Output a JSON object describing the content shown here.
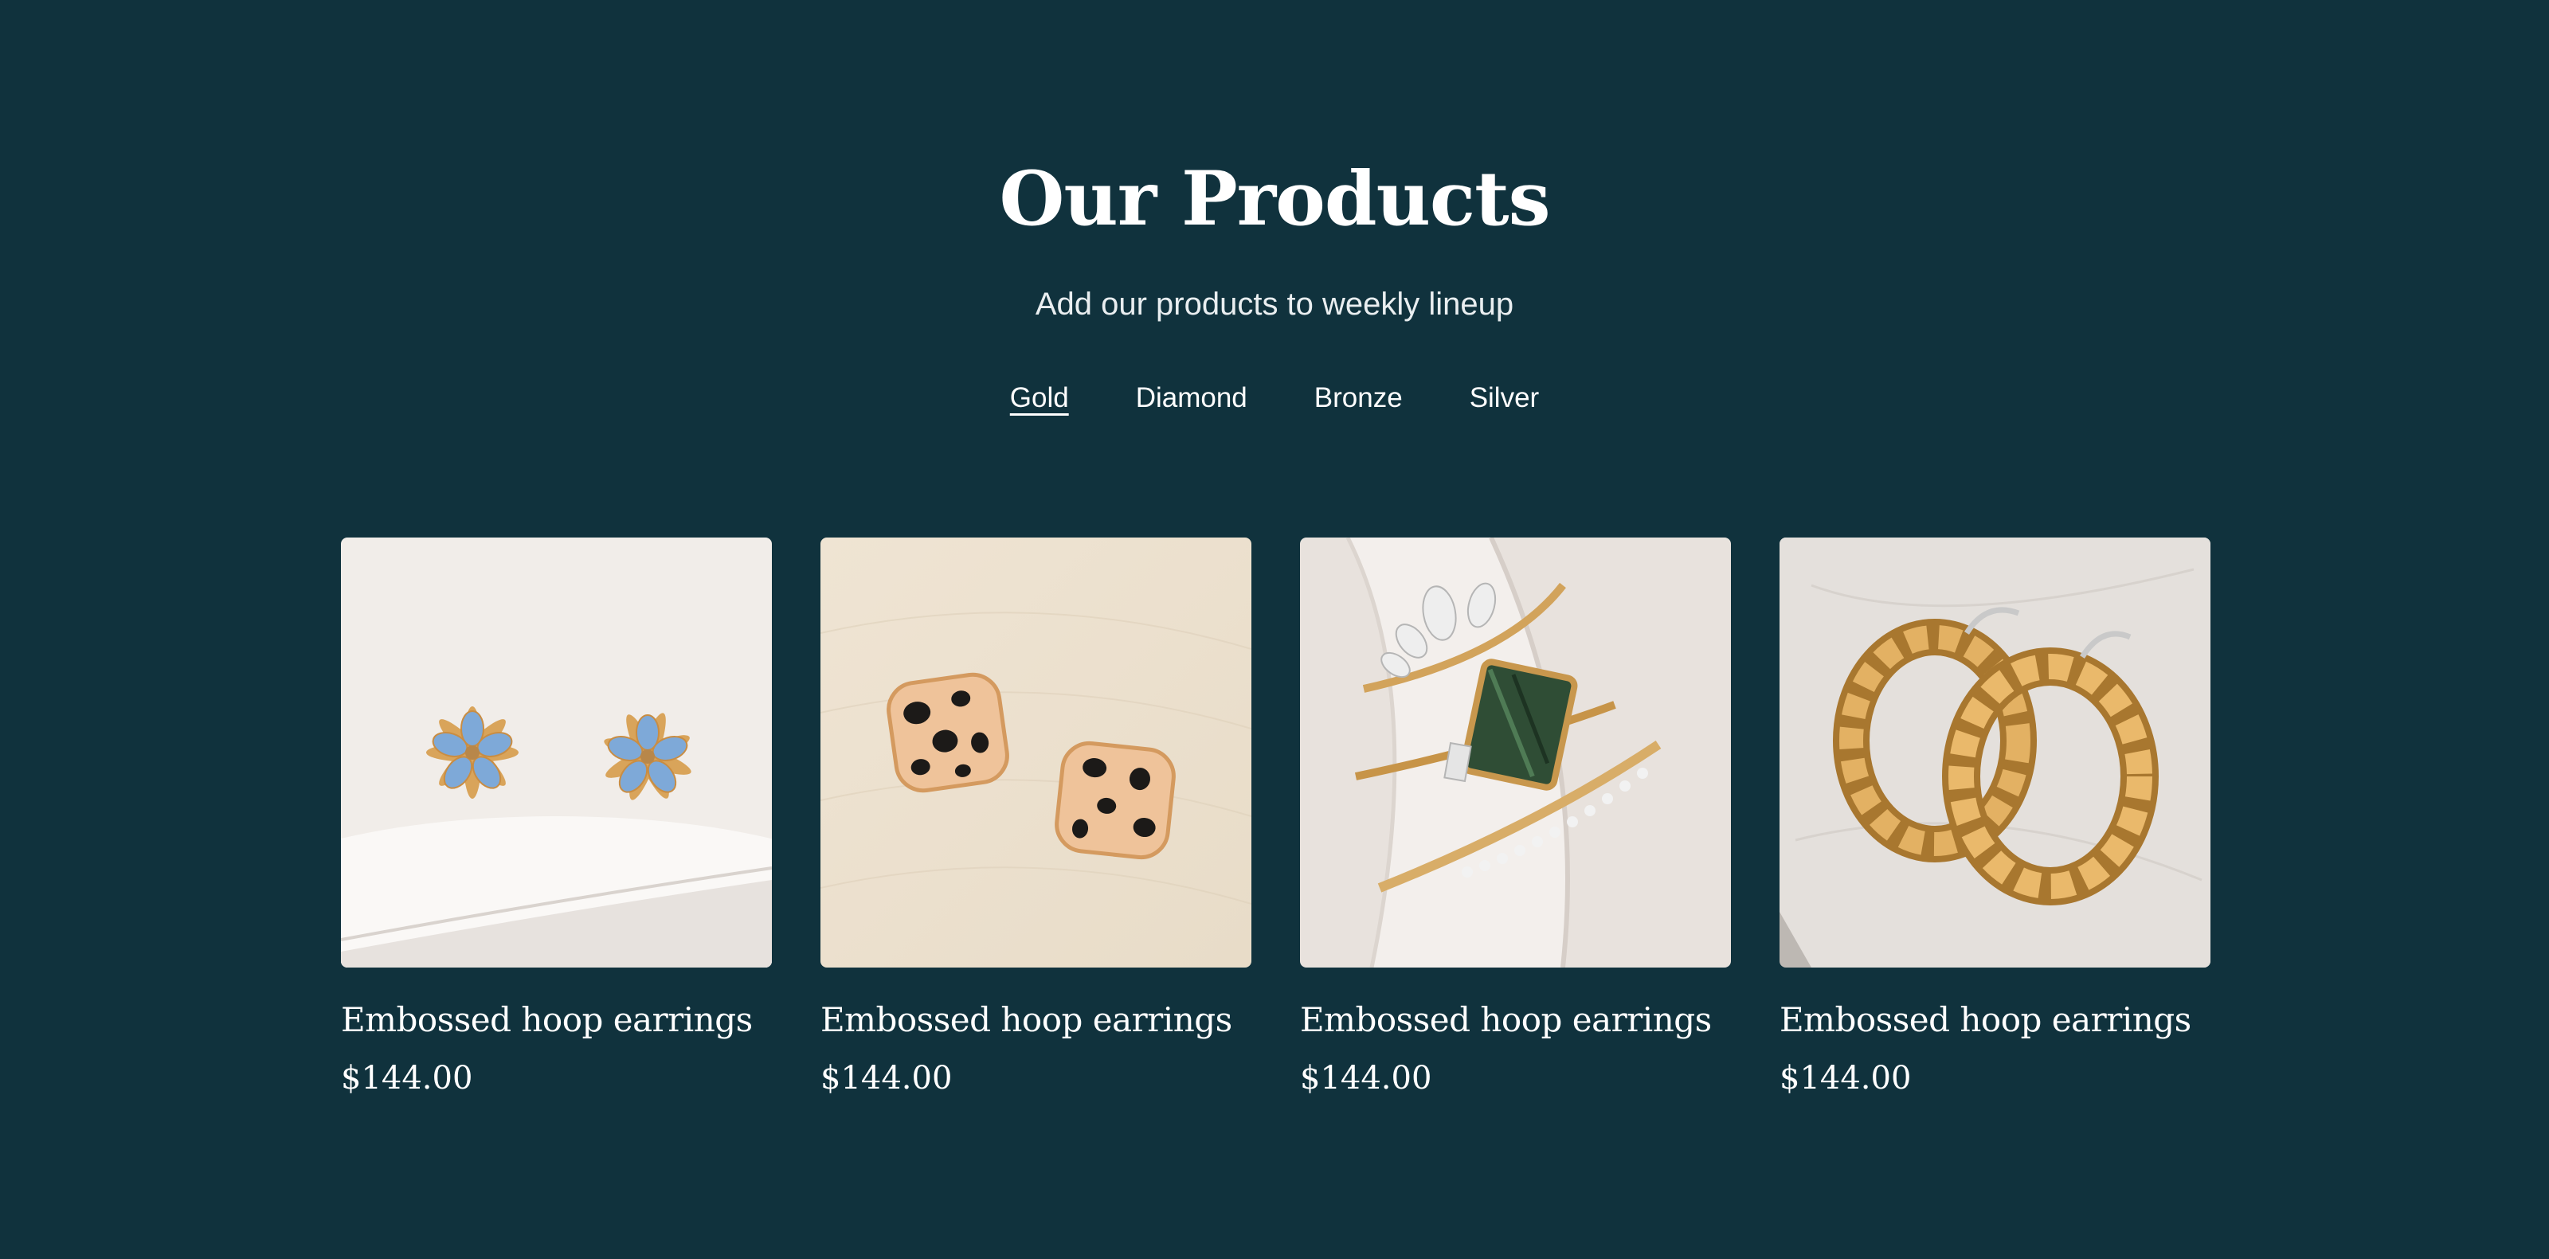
{
  "section": {
    "title": "Our Products",
    "subtitle": "Add our products to weekly lineup",
    "tabs": [
      {
        "label": "Gold",
        "active": true
      },
      {
        "label": "Diamond",
        "active": false
      },
      {
        "label": "Bronze",
        "active": false
      },
      {
        "label": "Silver",
        "active": false
      }
    ]
  },
  "products": [
    {
      "name": "Embossed hoop earrings",
      "price": "$144.00",
      "image": "blue-flower-stud-earrings"
    },
    {
      "name": "Embossed hoop earrings",
      "price": "$144.00",
      "image": "dalmatian-square-stud-earrings"
    },
    {
      "name": "Embossed hoop earrings",
      "price": "$144.00",
      "image": "stacked-gold-rings-green-stone"
    },
    {
      "name": "Embossed hoop earrings",
      "price": "$144.00",
      "image": "twisted-gold-hoop-earrings"
    }
  ],
  "colors": {
    "background": "#10323d",
    "text": "#ffffff"
  }
}
